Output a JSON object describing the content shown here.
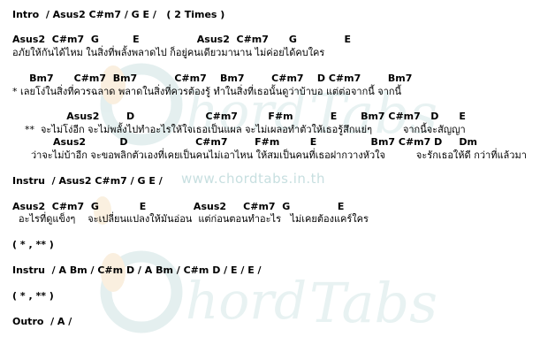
{
  "sheet": {
    "watermark": {
      "url": "www.chordtabs.in.th",
      "logo_text": "Chord Tabs"
    },
    "lines": [
      {
        "kind": "chord",
        "text": "Intro  / Asus2 C#m7 / G E /   ( 2 Times )"
      },
      {
        "kind": "chord",
        "text": "Asus2  C#m7  G          E                 Asus2  C#m7      G              E"
      },
      {
        "kind": "lyric",
        "text": "อภัยให้กันได้ไหม ในสิ่งที่พลั้งพลาดไป ก็อยู่คนเดียวมานาน ไม่ค่อยได้คบใคร"
      },
      {
        "kind": "chord",
        "text": "     Bm7      C#m7  Bm7           C#m7    Bm7        C#m7    D C#m7        Bm7"
      },
      {
        "kind": "lyric",
        "text": "* เลยโง่ในสิ่งที่ควรฉลาด พลาดในสิ่งที่ควรต้องรู้ ทำในสิ่งที่เธอนั้นดูว่าบ้าบอ แต่ต่อจากนี้ จากนี้"
      },
      {
        "kind": "chord",
        "text": "                Asus2        D                     C#m7         F#m           E       Bm7 C#m7   D      E"
      },
      {
        "kind": "lyric",
        "text": "    **  จะไม่โง่อีก จะไม่พลั้งไปทำอะไรให้ใจเธอเป็นแผล จะไม่เผลอทำตัวให้เธอรู้สึกแย่ๆ          จากนี้จะสัญญา"
      },
      {
        "kind": "chord",
        "text": "            Asus2          D                    C#m7        F#m         E                Bm7 C#m7 D     Dm"
      },
      {
        "kind": "lyric",
        "text": "      ว่าจะไม่บ้าอีก จะขอพลิกตัวเองที่เคยเป็นคนไม่เอาไหน ให้สมเป็นคนที่เธอฝากวางหัวใจ          จะรักเธอให้ดี กว่าที่แล้วมา"
      },
      {
        "kind": "chord",
        "text": "Instru  / Asus2 C#m7 / G E /"
      },
      {
        "kind": "chord",
        "text": "Asus2  C#m7  G            E              Asus2     C#m7  G              E"
      },
      {
        "kind": "lyric",
        "text": "  อะไรที่ดูแข็งๆ    จะเปลี่ยนแปลงให้มันอ่อน  แต่ก่อนตอนทำอะไร   ไม่เคยต้องแคร์ใคร"
      },
      {
        "kind": "chord",
        "text": "( * , ** )"
      },
      {
        "kind": "chord",
        "text": "Instru  / A Bm / C#m D / A Bm / C#m D / E / E /"
      },
      {
        "kind": "chord",
        "text": "( * , ** )"
      },
      {
        "kind": "chord",
        "text": "Outro  / A /"
      }
    ]
  }
}
